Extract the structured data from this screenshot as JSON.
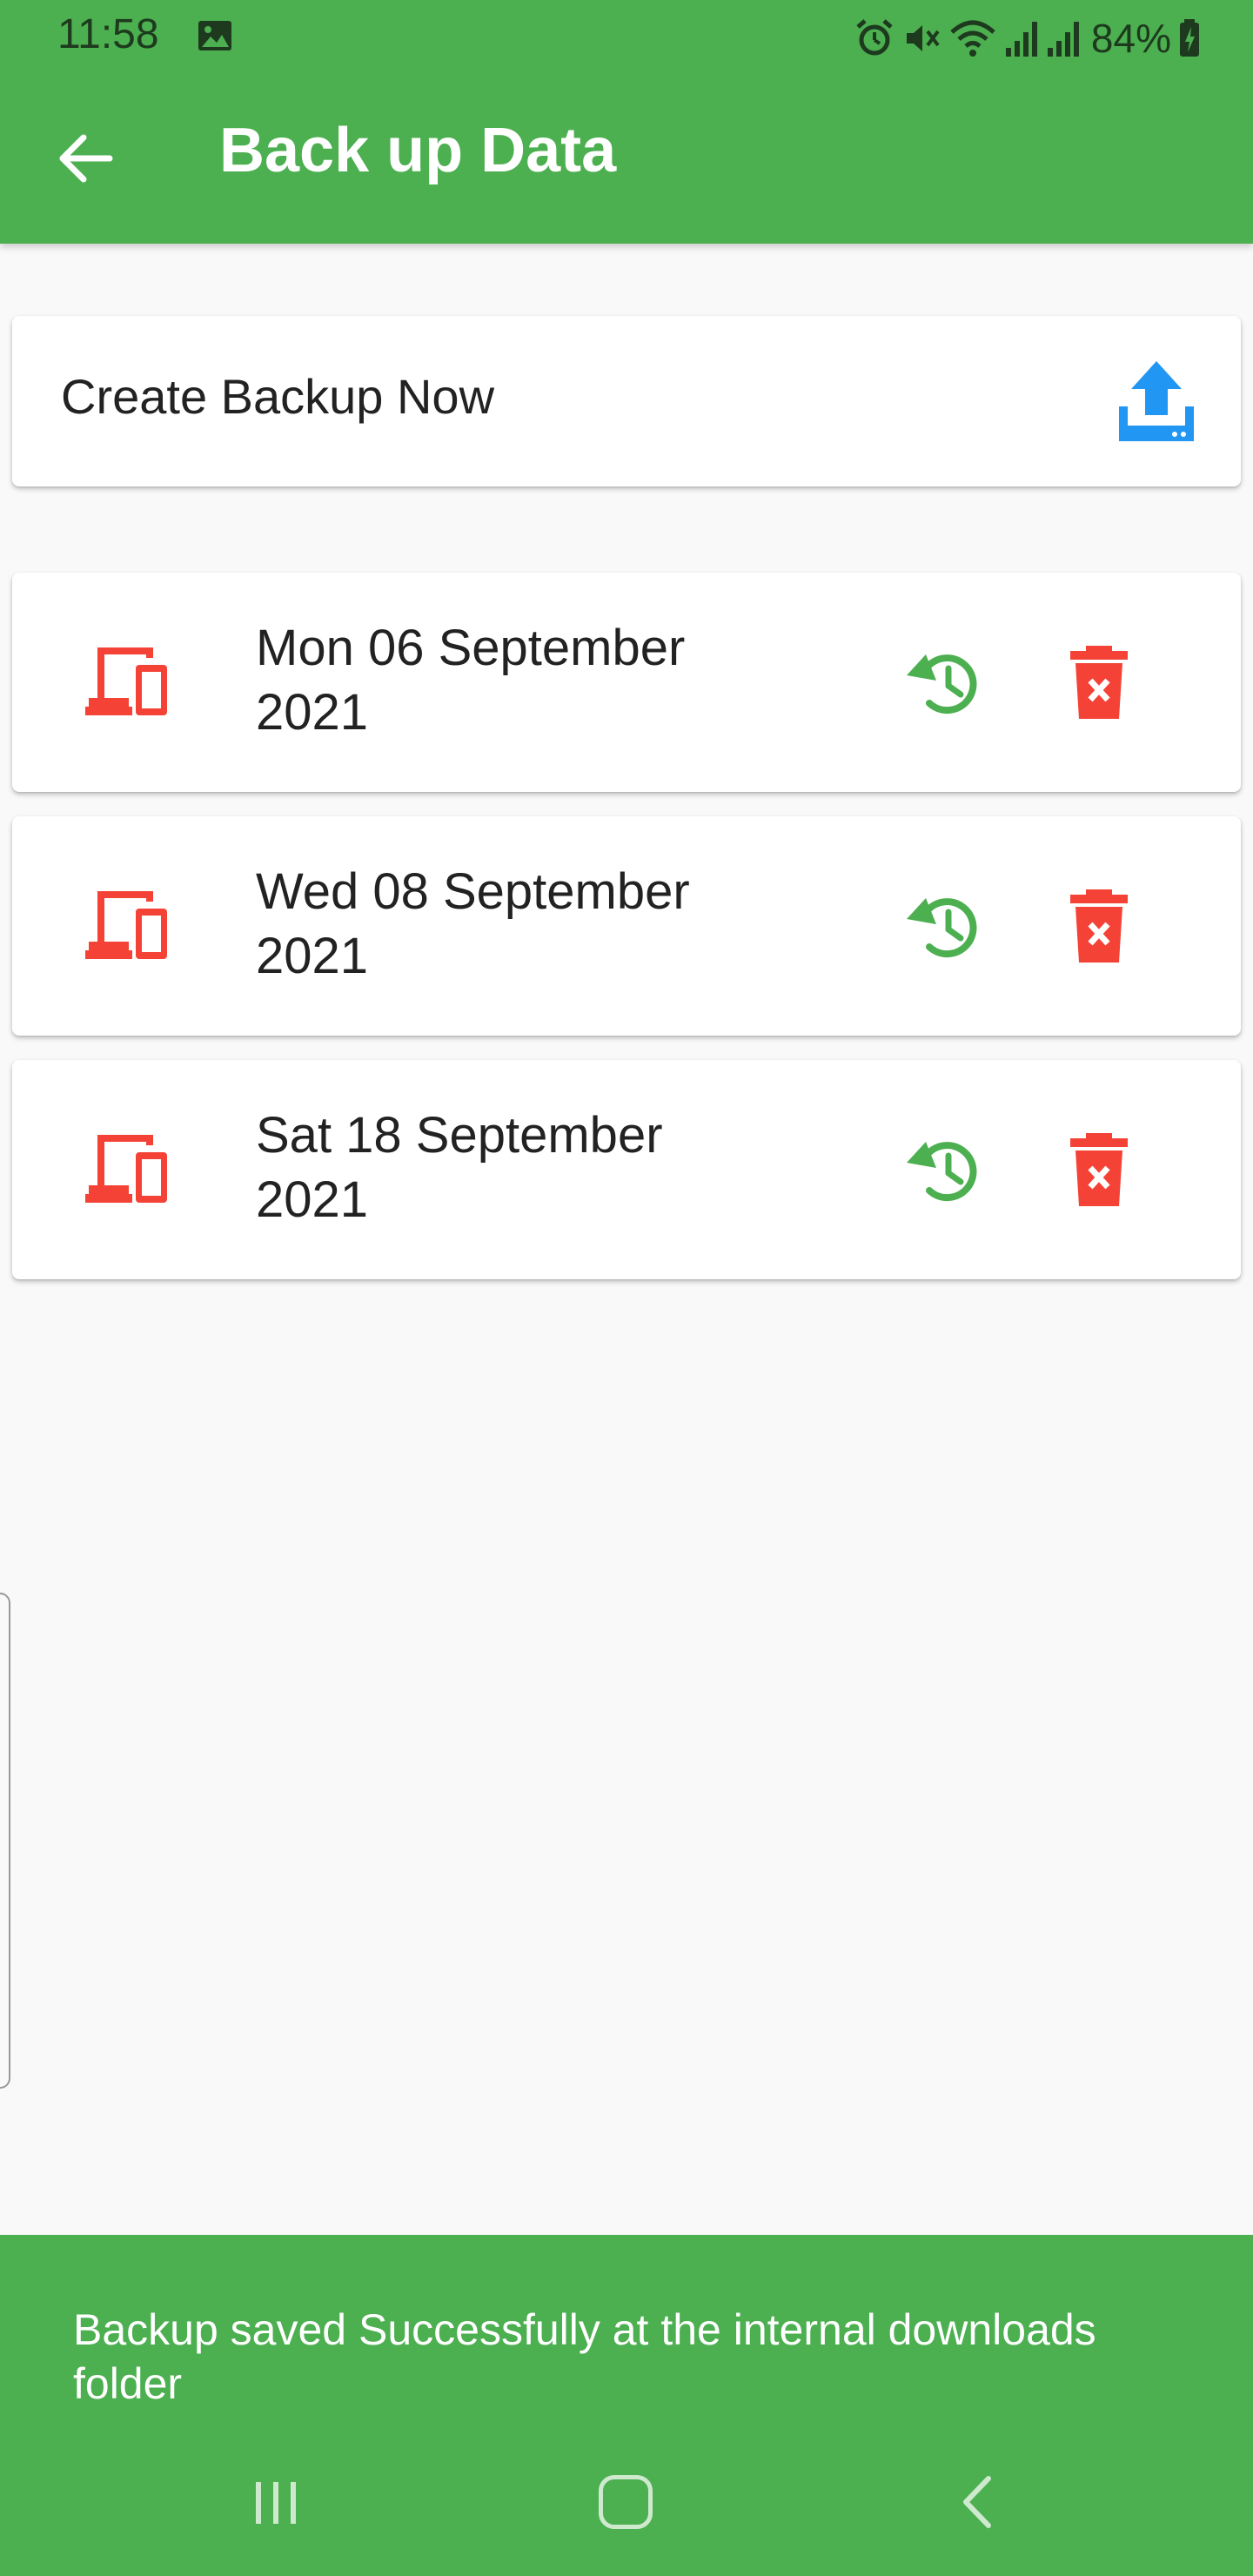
{
  "status_bar": {
    "time": "11:58",
    "battery": "84%"
  },
  "header": {
    "title": "Back up Data"
  },
  "create_backup": {
    "label": "Create Backup Now"
  },
  "backups": [
    {
      "date_line1": "Mon 06 September",
      "date_line2": "2021"
    },
    {
      "date_line1": "Wed 08 September",
      "date_line2": "2021"
    },
    {
      "date_line1": "Sat 18 September",
      "date_line2": "2021"
    }
  ],
  "snackbar": {
    "message": "Backup saved Successfully at the internal downloads folder"
  },
  "colors": {
    "primary": "#4caf50",
    "upload_icon": "#2196f3",
    "device_icon": "#f44336",
    "restore_icon": "#4caf50",
    "delete_icon": "#f44336"
  },
  "icons": {
    "back": "arrow-left-icon",
    "upload": "upload-icon",
    "device": "devices-icon",
    "restore": "history-icon",
    "delete": "delete-forever-icon"
  }
}
